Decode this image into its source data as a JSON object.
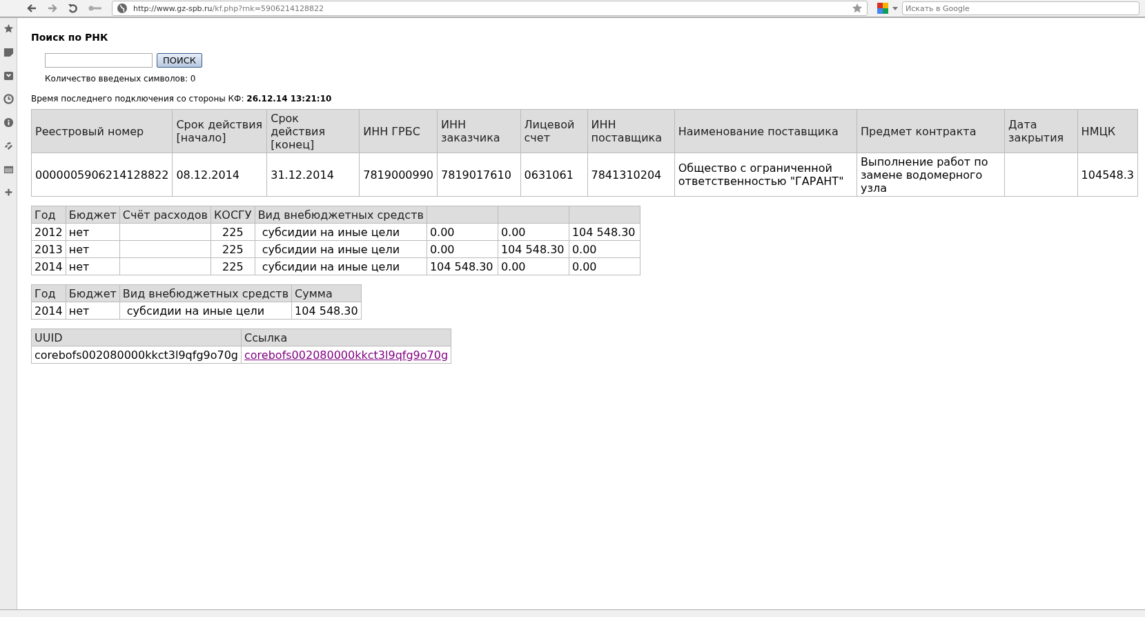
{
  "browser": {
    "url_host": "http://www.gz-spb.ru",
    "url_path": "/kf.php?rnk=5906214128822",
    "search_placeholder": "Искать в Google"
  },
  "page": {
    "title": "Поиск по РНК",
    "search_button": "ПОИСК",
    "counter": "Количество введеных символов: 0",
    "connection_label": "Время последнего подключения со стороны КФ:",
    "connection_time": "26.12.14 13:21:10"
  },
  "contract_table": {
    "columns": [
      "Реестровый номер",
      "Срок действия [начало]",
      "Срок действия [конец]",
      "ИНН ГРБС",
      "ИНН заказчика",
      "Лицевой счет",
      "ИНН поставщика",
      "Наименование поставщика",
      "Предмет контракта",
      "Дата закрытия",
      "НМЦК"
    ],
    "rows": [
      [
        "0000005906214128822",
        "08.12.2014",
        "31.12.2014",
        "7819000990",
        "7819017610",
        "0631061",
        "7841310204",
        "Общество с ограниченной ответственностью \"ГАРАНТ\"",
        "Выполнение работ по замене водомерного узла",
        null,
        "104548.3"
      ]
    ]
  },
  "budget_table": {
    "columns": [
      "Год",
      "Бюджет",
      "Счёт расходов",
      "КОСГУ",
      "Вид внебюджетных средств",
      null,
      null,
      null
    ],
    "rows": [
      [
        "2012",
        "нет",
        null,
        "225",
        "субсидии на иные цели",
        "0.00",
        "0.00",
        "104 548.30"
      ],
      [
        "2013",
        "нет",
        null,
        "225",
        "субсидии на иные цели",
        "0.00",
        "104 548.30",
        "0.00"
      ],
      [
        "2014",
        "нет",
        null,
        "225",
        "субсидии на иные цели",
        "104 548.30",
        "0.00",
        "0.00"
      ]
    ]
  },
  "sum_table": {
    "columns": [
      "Год",
      "Бюджет",
      "Вид внебюджетных средств",
      "Сумма"
    ],
    "rows": [
      [
        "2014",
        "нет",
        "субсидии на иные цели",
        "104 548.30"
      ]
    ]
  },
  "uuid_table": {
    "columns": [
      "UUID",
      "Ссылка"
    ],
    "rows": [
      {
        "uuid": "corebofs002080000kkct3l9qfg9o70g",
        "link": "corebofs002080000kkct3l9qfg9o70g"
      }
    ]
  }
}
